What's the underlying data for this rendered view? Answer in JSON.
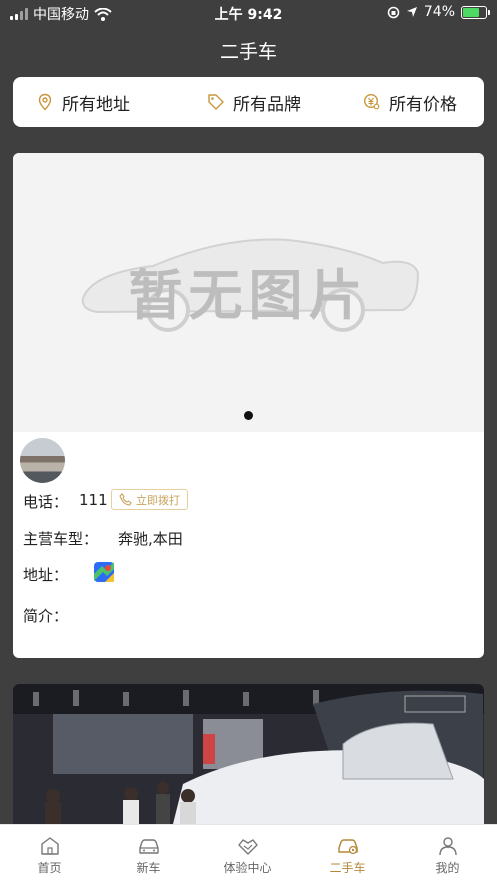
{
  "status_bar": {
    "carrier": "中国移动",
    "time": "上午 9:42",
    "battery": "74%",
    "battery_level": 0.74
  },
  "nav": {
    "title": "二手车"
  },
  "filters": [
    {
      "label": "所有地址",
      "icon": "location-pin-icon"
    },
    {
      "label": "所有品牌",
      "icon": "tag-icon"
    },
    {
      "label": "所有价格",
      "icon": "price-search-icon"
    }
  ],
  "card": {
    "placeholder_text": "暂无图片",
    "phone_label": "电话：",
    "phone_value": "111",
    "call_button": "立即拨打",
    "models_label": "主营车型：",
    "models_value": "奔驰,本田",
    "address_label": "地址：",
    "intro_label": "简介："
  },
  "tabs": [
    {
      "label": "首页",
      "icon": "home-icon",
      "active": false
    },
    {
      "label": "新车",
      "icon": "car-icon",
      "active": false
    },
    {
      "label": "体验中心",
      "icon": "handshake-icon",
      "active": false
    },
    {
      "label": "二手车",
      "icon": "used-car-icon",
      "active": true
    },
    {
      "label": "我的",
      "icon": "user-icon",
      "active": false
    }
  ],
  "colors": {
    "accent": "#b58a3c",
    "background": "#3f3f3f"
  }
}
